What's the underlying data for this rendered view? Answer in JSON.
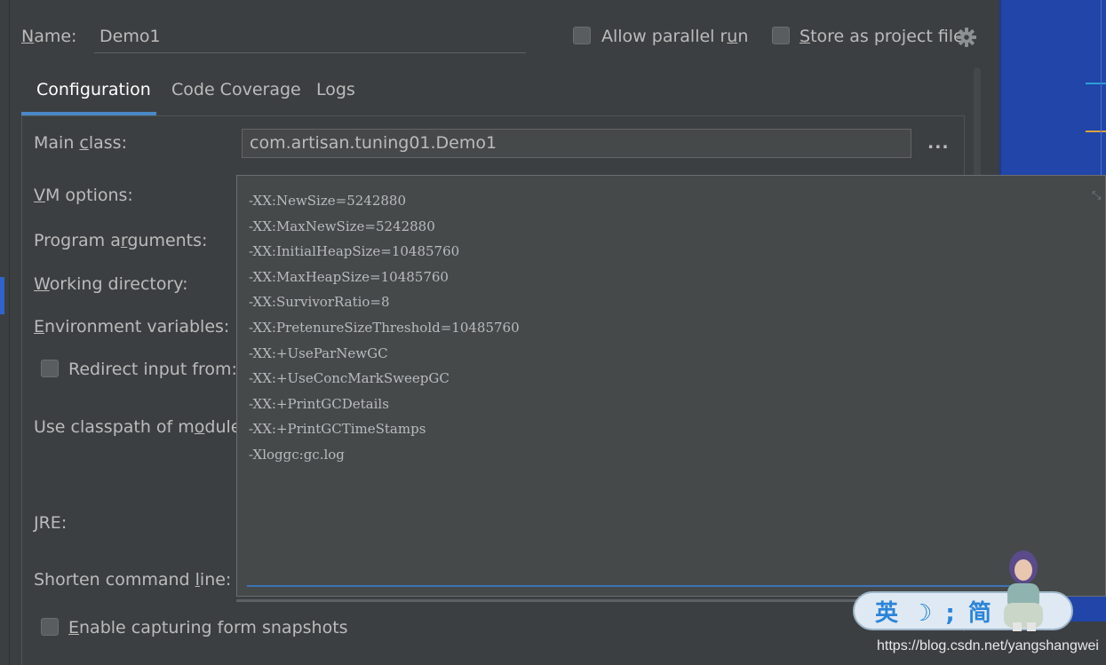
{
  "header": {
    "name_label_prefix": "",
    "name_label_mnemonic": "N",
    "name_label_rest": "ame:",
    "name_value": "Demo1",
    "allow_parallel_pre": "Allow parallel r",
    "allow_parallel_mn": "u",
    "allow_parallel_post": "n",
    "store_mn": "S",
    "store_rest": "tore as project file"
  },
  "tabs": [
    {
      "label": "Configuration"
    },
    {
      "label": "Code Coverage"
    },
    {
      "label": "Logs"
    }
  ],
  "form": {
    "main_class": {
      "pre": "Main ",
      "mn": "c",
      "post": "lass:",
      "value": "com.artisan.tuning01.Demo1",
      "browse": "..."
    },
    "vm_options": {
      "pre": "",
      "mn": "V",
      "post": "M options:"
    },
    "program_arguments": {
      "pre": "Program a",
      "mn": "r",
      "post": "guments:"
    },
    "working_directory": {
      "pre": "",
      "mn": "W",
      "post": "orking directory:"
    },
    "environment_variables": {
      "pre": "",
      "mn": "E",
      "post": "nvironment variables:"
    },
    "redirect_input": {
      "label": "Redirect input from:"
    },
    "classpath_module": {
      "pre": "Use classpath of m",
      "mn": "o",
      "post": "dule:"
    },
    "jre": {
      "pre": "",
      "mn": "J",
      "post": "RE:"
    },
    "shorten_command": {
      "pre": "Shorten command ",
      "mn": "l",
      "post": "ine:"
    },
    "capture_snapshots": {
      "pre": "",
      "mn": "E",
      "post": "nable capturing form snapshots"
    }
  },
  "vm_options_lines": [
    "-XX:NewSize=5242880",
    "-XX:MaxNewSize=5242880",
    "-XX:InitialHeapSize=10485760",
    "-XX:MaxHeapSize=10485760",
    "-XX:SurvivorRatio=8",
    "-XX:PretenureSizeThreshold=10485760",
    "-XX:+UseParNewGC",
    "-XX:+UseConcMarkSweepGC",
    "-XX:+PrintGCDetails",
    "-XX:+PrintGCTimeStamps",
    "-Xloggc:gc.log"
  ],
  "overlay": {
    "ime_text": "英 ☽ ; 简",
    "watermark": "https://blog.csdn.net/yangshangwei"
  },
  "colors": {
    "background": "#3c3f41",
    "accent": "#4a88c7",
    "text": "#bbbbbb",
    "right_panel": "#2145a8"
  }
}
